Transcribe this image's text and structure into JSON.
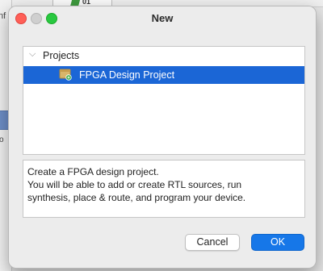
{
  "dialog": {
    "title": "New"
  },
  "tree": {
    "header_label": "Projects",
    "items": [
      {
        "label": "FPGA Design Project",
        "selected": true
      }
    ]
  },
  "description": {
    "lines": [
      "Create a FPGA design project.",
      "You will be able to add or create RTL sources, run",
      "synthesis, place & route, and program your device."
    ]
  },
  "buttons": {
    "cancel": "Cancel",
    "ok": "OK"
  },
  "background": {
    "snippet_left": "nf",
    "snippet_o": "o",
    "chip_text": "01"
  },
  "colors": {
    "selection": "#1b66d6",
    "ok_button": "#1677e8"
  },
  "icons": {
    "close": "close-dot-icon",
    "minimize": "minimize-dot-icon",
    "maximize": "maximize-dot-icon",
    "expand": "chevron-down-icon",
    "project": "fpga-project-icon"
  }
}
